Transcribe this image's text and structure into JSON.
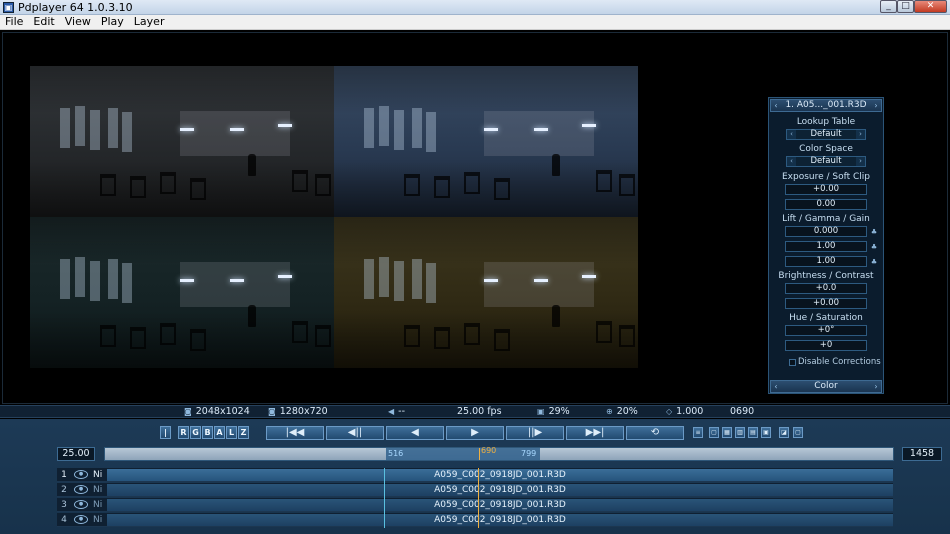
{
  "window": {
    "title": "Pdplayer 64 1.0.3.10",
    "icon": "app-icon"
  },
  "menu": {
    "items": [
      "File",
      "Edit",
      "View",
      "Play",
      "Layer"
    ]
  },
  "panel": {
    "header_title": "1. A05..._001.R3D",
    "lookup_label": "Lookup Table",
    "lookup_value": "Default",
    "colorspace_label": "Color Space",
    "colorspace_value": "Default",
    "exposure_label": "Exposure / Soft Clip",
    "exposure_value": "+0.00",
    "softclip_value": "0.00",
    "lgg_label": "Lift / Gamma / Gain",
    "lift_value": "0.000",
    "gamma_value": "1.00",
    "gain_value": "1.00",
    "bc_label": "Brightness / Contrast",
    "brightness_value": "+0.0",
    "contrast_value": "+0.00",
    "hs_label": "Hue / Saturation",
    "hue_value": "+0°",
    "saturation_value": "+0",
    "disable_label": "Disable Corrections",
    "disable_checked": false,
    "footer_title": "Color"
  },
  "info": {
    "source_res": "2048x1024",
    "view_res": "1280x720",
    "audio": "--",
    "fps": "25.00 fps",
    "load_pct": "29%",
    "zoom": "20%",
    "aspect": "1.000",
    "frame": "0690"
  },
  "toolbar": {
    "channels": [
      "R",
      "G",
      "B",
      "A",
      "L",
      "Z"
    ],
    "transport": [
      "|◀◀",
      "◀||",
      "◀",
      "▶",
      "||▶",
      "▶▶|",
      "⟲"
    ]
  },
  "timeline": {
    "fps_field": "25.00",
    "end_field": "1458",
    "in_point": "516",
    "out_point": "799",
    "current_frame": "690"
  },
  "layers": [
    {
      "num": "1",
      "flag": "Ni",
      "clip": "A059_C002_0918JD_001.R3D",
      "active": true
    },
    {
      "num": "2",
      "flag": "Ni",
      "clip": "A059_C002_0918JD_001.R3D",
      "active": false
    },
    {
      "num": "3",
      "flag": "Ni",
      "clip": "A059_C002_0918JD_001.R3D",
      "active": false
    },
    {
      "num": "4",
      "flag": "Ni",
      "clip": "A059_C002_0918JD_001.R3D",
      "active": false
    }
  ],
  "colors": {
    "accent": "#2b5477",
    "cursor": "#f0b040",
    "in_marker": "#5ac0e0"
  }
}
